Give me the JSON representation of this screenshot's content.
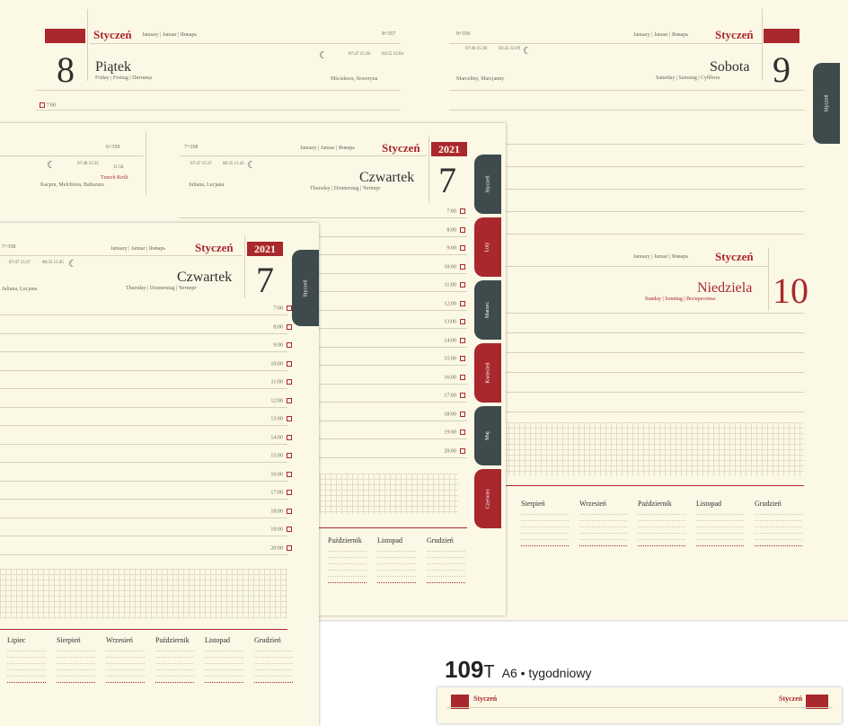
{
  "pages": {
    "back": {
      "left": {
        "month": "Styczeń",
        "month_alt": "January | Januar | Январь",
        "day_count": "8+357",
        "day_number": "8",
        "day_name": "Piątek",
        "day_name_alt": "Friday | Freitag | Пятница",
        "sun": "07:47 15:36",
        "moon": "03:55 12:04",
        "names": "Mścisława, Seweryna",
        "first_hour": "7:00"
      },
      "right": {
        "day_count": "9+356",
        "month": "Styczeń",
        "month_alt": "January | Januar | Январь",
        "day_number": "9",
        "day_name": "Sobota",
        "day_name_alt": "Saturday | Samstag | Суббота",
        "sun": "07:46 15:38",
        "moon": "03:25 12:29",
        "names": "Marceliny, Marcjanny",
        "tab": "Styczeń"
      },
      "sunday": {
        "month": "Styczeń",
        "month_alt": "January | Januar | Январь",
        "day_number": "10",
        "day_name": "Niedziela",
        "day_name_alt": "Sunday | Sonntag | Воскресенье"
      }
    },
    "middle": {
      "left": {
        "day_count": "6+359",
        "sun": "07:48 15:35",
        "moon_phase": "11:58",
        "holiday": "Trzech Króli",
        "names": "Kacpra, Melchiora, Baltazara"
      },
      "right": {
        "day_count": "7+358",
        "month": "Styczeń",
        "month_alt": "January | Januar | Январь",
        "year": "2021",
        "day_number": "7",
        "day_name": "Czwartek",
        "day_name_alt": "Thursday | Donnerstag | Четверг",
        "sun": "07:47 15:37",
        "moon": "00:35 11:45",
        "names": "Juliana, Lucjana"
      }
    },
    "front": {
      "day_count": "7+358",
      "month": "Styczeń",
      "month_alt": "January | Januar | Январь",
      "year": "2021",
      "day_number": "7",
      "day_name": "Czwartek",
      "day_name_alt": "Thursday | Donnerstag | Четверг",
      "sun": "07:47 15:37",
      "moon": "00:35 11:45",
      "names": "Juliana, Lucjana",
      "tab": "Styczeń"
    }
  },
  "hours": [
    "7:00",
    "8:00",
    "9:00",
    "10:00",
    "11:00",
    "12:00",
    "13:00",
    "14:00",
    "15:00",
    "16:00",
    "17:00",
    "18:00",
    "19:00",
    "20:00"
  ],
  "tabs": [
    "Styczeń",
    "Luty",
    "Marzec",
    "Kwiecień",
    "Maj",
    "Czerwiec"
  ],
  "months_front": [
    "Lipiec",
    "Sierpień",
    "Wrzesień",
    "Październik",
    "Listopad",
    "Grudzień"
  ],
  "months_middle": [
    "Październik",
    "Listopad",
    "Grudzień"
  ],
  "months_back": [
    "Sierpień",
    "Wrzesień",
    "Październik",
    "Listopad",
    "Grudzień"
  ],
  "product": {
    "code": "109",
    "suffix": "T",
    "desc": "A6 • tygodniowy"
  },
  "colors": {
    "accent": "#a9282d",
    "paper": "#fbf8e6",
    "tab_dark": "#3f4a4d"
  }
}
